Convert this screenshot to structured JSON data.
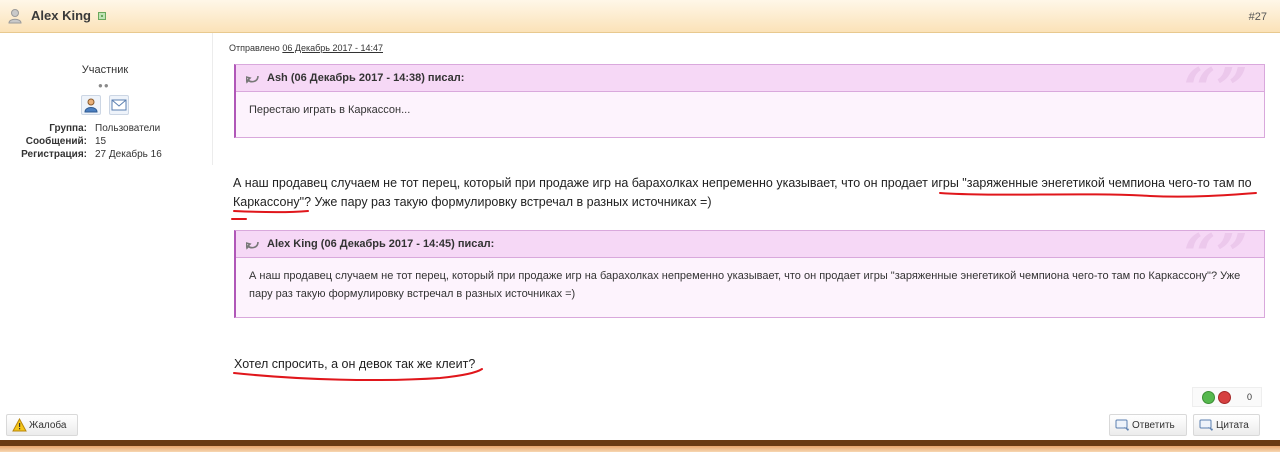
{
  "header": {
    "author": "Alex King",
    "post_number": "#27",
    "icons": [
      "user-icon",
      "online-status-icon"
    ]
  },
  "profile": {
    "role": "Участник",
    "pips": "●●",
    "icons": [
      "profile-card-icon",
      "send-message-icon"
    ],
    "fields": [
      {
        "label": "Группа:",
        "value": "Пользователи"
      },
      {
        "label": "Сообщений:",
        "value": "15"
      },
      {
        "label": "Регистрация:",
        "value": "27 Декабрь 16"
      }
    ]
  },
  "post": {
    "sent_label": "Отправлено",
    "sent_date": "06 Декабрь 2017 - 14:47",
    "quotes": [
      {
        "cite": "Ash (06 Декабрь 2017 - 14:38) писал:",
        "text": "Перестаю играть в Каркассон..."
      },
      {
        "cite": "Alex King (06 Декабрь 2017 - 14:45) писал:",
        "text": "А наш продавец случаем не тот перец, который при продаже игр на барахолках непременно указывает, что он продает игры \"заряженные энегетикой чемпиона чего-то там по Каркассону\"? Уже пару раз такую формулировку встречал в разных источниках =)"
      }
    ],
    "quote_marks": "“”",
    "paragraph1": "А наш продавец случаем не тот перец, который при продаже игр на барахолках непременно указывает, что он продает игры \"заряженные энегетикой чемпиона чего-то там по Каркассону\"? Уже пару раз такую формулировку встречал в разных источниках =)",
    "paragraph2": "Хотел спросить, а он девок так же клеит?"
  },
  "rating": {
    "count": "0",
    "icons": [
      "rate-up-icon",
      "rate-down-icon"
    ]
  },
  "buttons": {
    "report": "Жалоба",
    "reply": "Ответить",
    "quote": "Цитата"
  },
  "colors": {
    "header_bg": "#fbe2b8",
    "quote_bg": "#fdf3fd",
    "quote_head_bg": "#f6d8f6",
    "quote_border": "#b057b8",
    "annotation_red": "#e0161b",
    "footer_band": "#6b3a12"
  }
}
